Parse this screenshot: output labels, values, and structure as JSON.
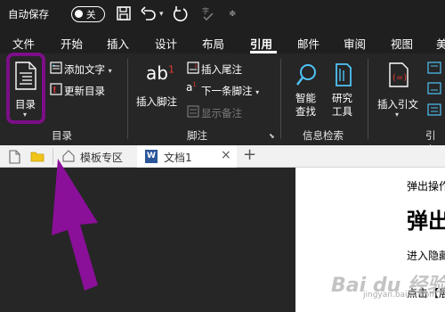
{
  "titlebar": {
    "autosave_label": "自动保存",
    "toggle_state": "关"
  },
  "ribbon_tabs": [
    {
      "label": "文件"
    },
    {
      "label": "开始"
    },
    {
      "label": "插入"
    },
    {
      "label": "设计"
    },
    {
      "label": "布局"
    },
    {
      "label": "引用",
      "active": true
    },
    {
      "label": "邮件"
    },
    {
      "label": "审阅"
    },
    {
      "label": "视图"
    },
    {
      "label": "美"
    }
  ],
  "groups": {
    "toc": {
      "label": "目录",
      "toc_button": "目录",
      "add_text": "添加文字",
      "update_toc": "更新目录"
    },
    "footnotes": {
      "label": "脚注",
      "insert_footnote": "插入脚注",
      "insert_endnote": "插入尾注",
      "next_footnote": "下一条脚注",
      "show_notes": "显示备注",
      "ab_icon_text": "ab",
      "ab_sup": "1"
    },
    "research": {
      "label": "信息检索",
      "smart_lookup_1": "智能",
      "smart_lookup_2": "查找",
      "research_1": "研究",
      "research_2": "工具"
    },
    "citations": {
      "label": "引文",
      "insert_citation": "插入引文"
    }
  },
  "doc_tabs": {
    "template_zone": "模板专区",
    "doc1": "文档1",
    "close": "×",
    "add": "+"
  },
  "document": {
    "line1": "弹出操作",
    "heading": "弹出",
    "line2": "进入隐藏",
    "line3": "点击【展"
  },
  "watermark": {
    "text": "Bai du 经验",
    "url": "jingyan.baidu.com"
  },
  "colors": {
    "highlight": "#7b0f87",
    "arrow": "#8a0f99",
    "ribbon_bg": "#262626",
    "title_bg": "#1f1f1f",
    "word_blue": "#2b579a",
    "folder_yellow": "#f0c419"
  }
}
